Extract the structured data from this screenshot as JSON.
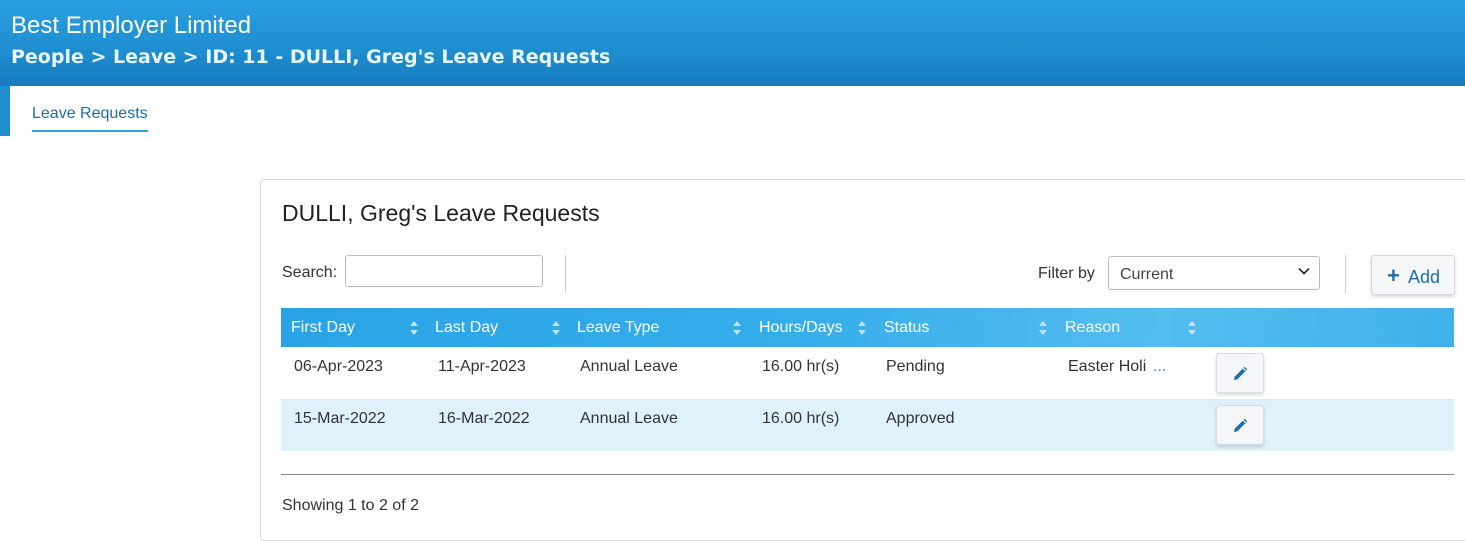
{
  "header": {
    "app_title": "Best Employer Limited",
    "breadcrumb": "People > Leave > ID: 11 - DULLI, Greg's Leave Requests",
    "color": "#1f8fd0"
  },
  "tabs": [
    {
      "label": "Leave Requests",
      "active": true
    }
  ],
  "panel": {
    "title": "DULLI, Greg's Leave Requests",
    "search": {
      "label": "Search:",
      "value": "",
      "placeholder": ""
    },
    "filter": {
      "label": "Filter by",
      "selected": "Current"
    },
    "add_button": {
      "label": "Add",
      "icon": "plus-icon"
    }
  },
  "table": {
    "columns": [
      "First Day",
      "Last Day",
      "Leave Type",
      "Hours/Days",
      "Status",
      "Reason"
    ],
    "rows": [
      {
        "first_day": "06-Apr-2023",
        "last_day": "11-Apr-2023",
        "leave_type": "Annual Leave",
        "hours": "16.00 hr(s)",
        "status": "Pending",
        "reason": "Easter Holi",
        "reason_more": "..."
      },
      {
        "first_day": "15-Mar-2022",
        "last_day": "16-Mar-2022",
        "leave_type": "Annual Leave",
        "hours": "16.00 hr(s)",
        "status": "Approved",
        "reason": "",
        "reason_more": ""
      }
    ],
    "header_color": "#2aa3e6",
    "highlight_row_color": "#dff1fb"
  },
  "footer": {
    "showing": "Showing 1 to 2 of 2"
  }
}
